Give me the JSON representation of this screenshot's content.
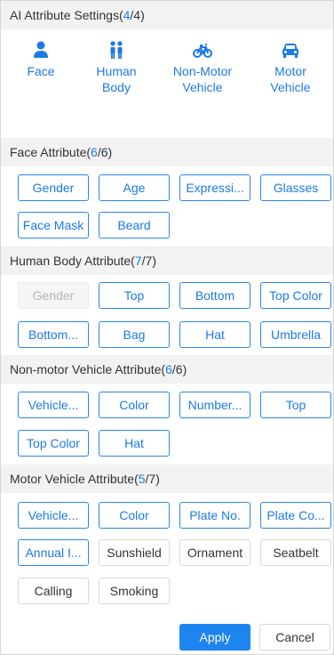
{
  "ai_settings": {
    "title": "AI Attribute Settings(",
    "count": "4",
    "total": "/4)"
  },
  "types": [
    {
      "label": "Face",
      "icon": "person-icon"
    },
    {
      "label": "Human Body",
      "icon": "people-icon"
    },
    {
      "label": "Non-Motor Vehicle",
      "icon": "bicycle-icon"
    },
    {
      "label": "Motor Vehicle",
      "icon": "car-icon"
    }
  ],
  "face": {
    "title": "Face Attribute(",
    "count": "6",
    "total": "/6)",
    "buttons": [
      "Gender",
      "Age",
      "Expressi...",
      "Glasses",
      "Face Mask",
      "Beard"
    ]
  },
  "body": {
    "title": "Human Body Attribute(",
    "count": "7",
    "total": "/7)",
    "buttons": [
      "Gender",
      "Top",
      "Bottom",
      "Top Color",
      "Bottom...",
      "Bag",
      "Hat",
      "Umbrella"
    ]
  },
  "nonmotor": {
    "title": "Non-motor Vehicle Attribute(",
    "count": "6",
    "total": "/6)",
    "buttons": [
      "Vehicle...",
      "Color",
      "Number...",
      "Top",
      "Top Color",
      "Hat"
    ]
  },
  "motor": {
    "title": "Motor Vehicle Attribute(",
    "count": "5",
    "total": "/7)",
    "buttons": [
      "Vehicle...",
      "Color",
      "Plate No.",
      "Plate Co...",
      "Annual I...",
      "Sunshield",
      "Ornament",
      "Seatbelt",
      "Calling",
      "Smoking"
    ]
  },
  "footer": {
    "apply": "Apply",
    "cancel": "Cancel"
  },
  "colors": {
    "accent": "#1d79e6",
    "header_bg": "#f2f2f2",
    "apply_bg": "#1d84f0"
  }
}
